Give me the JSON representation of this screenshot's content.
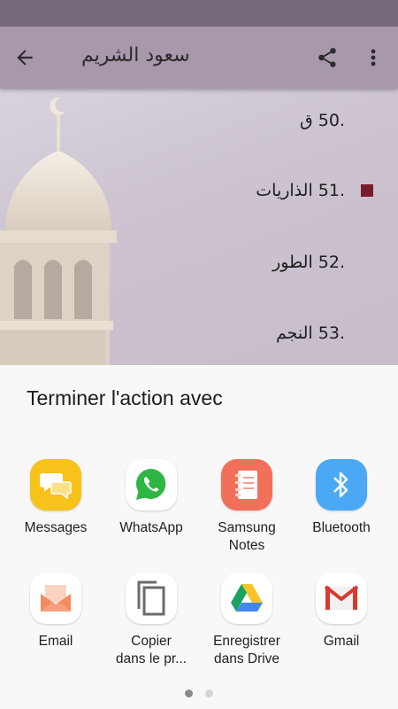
{
  "toolbar": {
    "title": "سعود الشريم"
  },
  "suras": [
    {
      "label": ".50 ق",
      "selected": false
    },
    {
      "label": ".51 الذاريات",
      "selected": true
    },
    {
      "label": ".52 الطور",
      "selected": false
    },
    {
      "label": ".53 النجم",
      "selected": false
    }
  ],
  "share_sheet": {
    "title": "Terminer l'action avec",
    "apps": [
      {
        "label": "Messages",
        "icon": "messages-icon"
      },
      {
        "label": "WhatsApp",
        "icon": "whatsapp-icon"
      },
      {
        "label": "Samsung\nNotes",
        "icon": "samsung-notes-icon"
      },
      {
        "label": "Bluetooth",
        "icon": "bluetooth-icon"
      },
      {
        "label": "Email",
        "icon": "email-icon"
      },
      {
        "label": "Copier\ndans le pr...",
        "icon": "copy-icon"
      },
      {
        "label": "Enregistrer\ndans Drive",
        "icon": "drive-icon"
      },
      {
        "label": "Gmail",
        "icon": "gmail-icon"
      }
    ],
    "page_count": 2,
    "active_page": 1
  },
  "colors": {
    "toolbar": "#a898ab",
    "status_bar": "#766a7c",
    "selected_marker": "#7a1b2b"
  }
}
